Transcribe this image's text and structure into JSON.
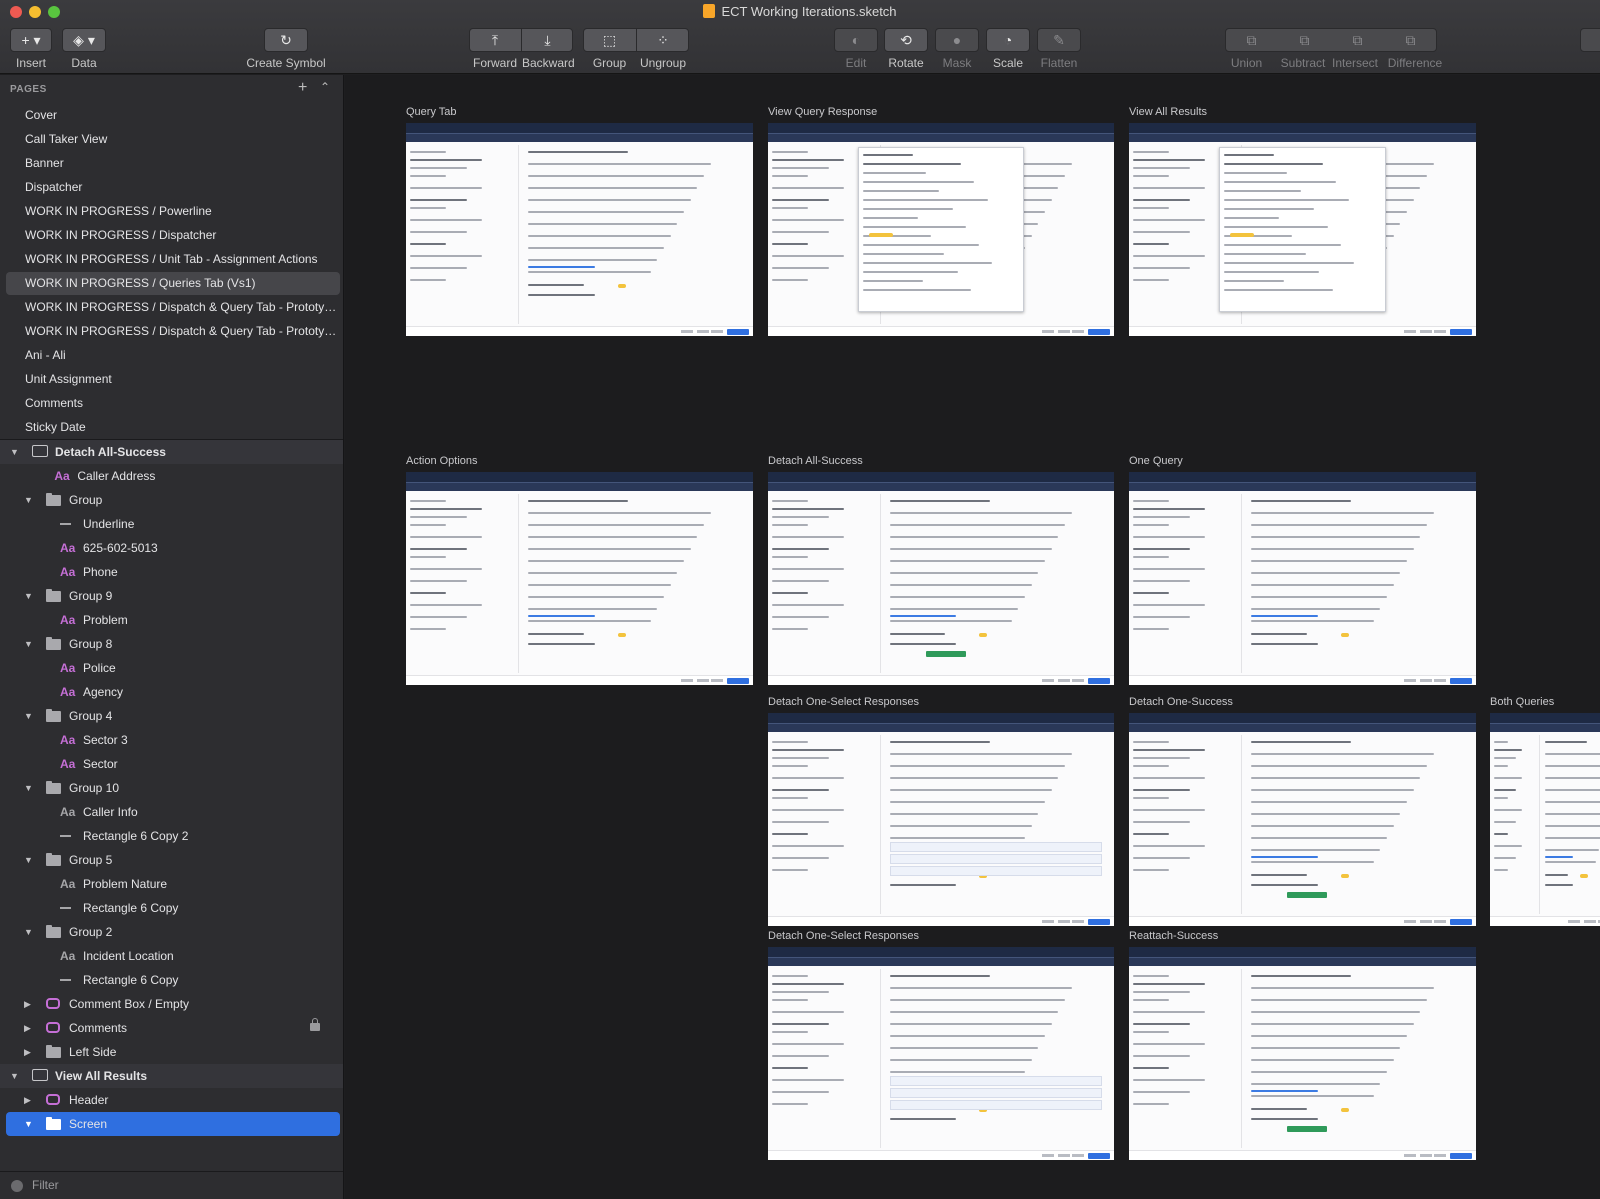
{
  "window": {
    "title": "ECT Working Iterations.sketch"
  },
  "toolbar": {
    "insert": "Insert",
    "data": "Data",
    "create_symbol": "Create Symbol",
    "forward": "Forward",
    "backward": "Backward",
    "group": "Group",
    "ungroup": "Ungroup",
    "edit": "Edit",
    "rotate": "Rotate",
    "mask": "Mask",
    "scale": "Scale",
    "flatten": "Flatten",
    "union": "Union",
    "subtract": "Subtract",
    "intersect": "Intersect",
    "difference": "Difference"
  },
  "sidebar": {
    "pages_heading": "PAGES",
    "pages": [
      {
        "label": "Cover"
      },
      {
        "label": "Call Taker View"
      },
      {
        "label": "Banner"
      },
      {
        "label": "Dispatcher"
      },
      {
        "label": "WORK IN PROGRESS / Powerline"
      },
      {
        "label": "WORK IN PROGRESS / Dispatcher"
      },
      {
        "label": "WORK IN PROGRESS / Unit Tab - Assignment Actions"
      },
      {
        "label": "WORK IN PROGRESS / Queries Tab (Vs1)",
        "selected": true
      },
      {
        "label": "WORK IN PROGRESS / Dispatch & Query Tab - Prototype (..."
      },
      {
        "label": "WORK IN PROGRESS / Dispatch & Query Tab - Prototype..."
      },
      {
        "label": "Ani - Ali"
      },
      {
        "label": "Unit Assignment"
      },
      {
        "label": "Comments"
      },
      {
        "label": "Sticky Date"
      }
    ],
    "layers": [
      {
        "label": "Detach All-Success",
        "kind": "artboard"
      },
      {
        "label": "Caller Address",
        "kind": "text"
      },
      {
        "label": "Group",
        "kind": "group"
      },
      {
        "label": "Underline",
        "kind": "line"
      },
      {
        "label": "625-602-5013",
        "kind": "text"
      },
      {
        "label": "Phone",
        "kind": "text"
      },
      {
        "label": "Group 9",
        "kind": "group"
      },
      {
        "label": "Problem",
        "kind": "text"
      },
      {
        "label": "Group 8",
        "kind": "group"
      },
      {
        "label": "Police",
        "kind": "text"
      },
      {
        "label": "Agency",
        "kind": "text"
      },
      {
        "label": "Group 4",
        "kind": "group"
      },
      {
        "label": "Sector 3",
        "kind": "text"
      },
      {
        "label": "Sector",
        "kind": "text"
      },
      {
        "label": "Group 10",
        "kind": "group"
      },
      {
        "label": "Caller Info",
        "kind": "text-grey"
      },
      {
        "label": "Rectangle 6 Copy 2",
        "kind": "line"
      },
      {
        "label": "Group 5",
        "kind": "group"
      },
      {
        "label": "Problem Nature",
        "kind": "text-grey"
      },
      {
        "label": "Rectangle 6 Copy",
        "kind": "line"
      },
      {
        "label": "Group 2",
        "kind": "group"
      },
      {
        "label": "Incident Location",
        "kind": "text-grey"
      },
      {
        "label": "Rectangle 6 Copy",
        "kind": "line"
      },
      {
        "label": "Comment Box / Empty",
        "kind": "symbol"
      },
      {
        "label": "Comments",
        "kind": "symbol"
      },
      {
        "label": "Left Side",
        "kind": "group-collapsed"
      },
      {
        "label": "View All Results",
        "kind": "artboard"
      },
      {
        "label": "Header",
        "kind": "symbol"
      },
      {
        "label": "Screen",
        "kind": "group-selected"
      }
    ],
    "filter": "Filter",
    "colors": {
      "selection": "#2f6fe0",
      "text_layer": "#c56fd6"
    }
  },
  "canvas": {
    "artboards": [
      {
        "title": "Query Tab",
        "kind": "query"
      },
      {
        "title": "View Query Response",
        "kind": "overlay"
      },
      {
        "title": "View All Results",
        "kind": "overlay"
      },
      {
        "title": "Action Options",
        "kind": "query"
      },
      {
        "title": "Detach All-Success",
        "kind": "toast"
      },
      {
        "title": "One Query",
        "kind": "query"
      },
      {
        "title": "Detach One-Select Responses",
        "kind": "select"
      },
      {
        "title": "Detach One-Success",
        "kind": "toast"
      },
      {
        "title": "Both Queries",
        "kind": "query"
      },
      {
        "title": "Detach One-Select Responses",
        "kind": "select"
      },
      {
        "title": "Reattach-Success",
        "kind": "toast"
      }
    ]
  }
}
